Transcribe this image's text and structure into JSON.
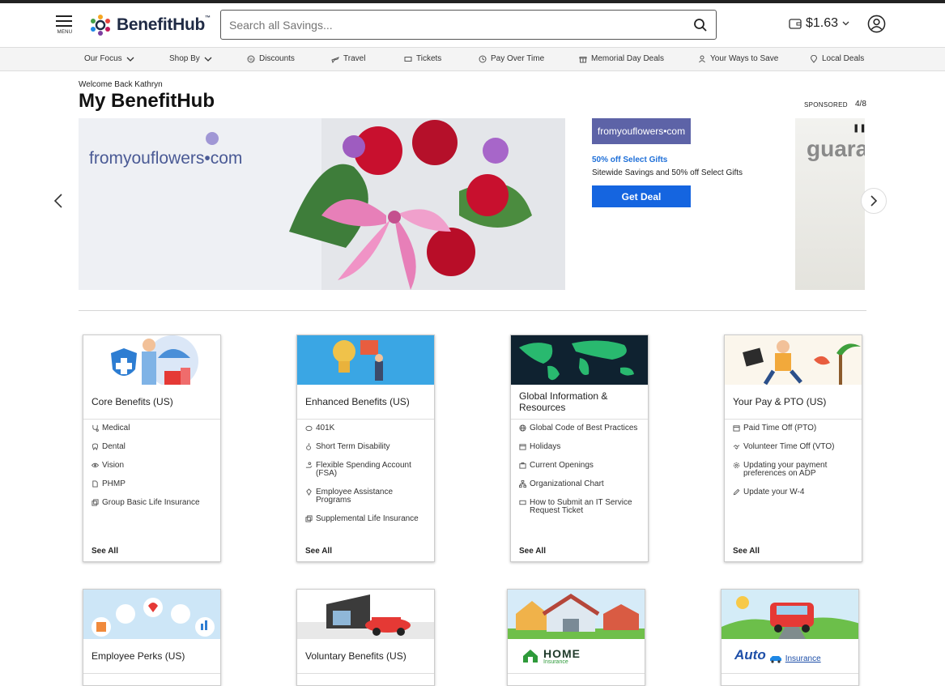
{
  "header": {
    "menu_label": "MENU",
    "logo_text": "BenefitHub",
    "logo_tm": "™",
    "search_placeholder": "Search all Savings...",
    "wallet_balance": "$1.63"
  },
  "nav": {
    "items": [
      "Our Focus",
      "Shop By",
      "Discounts",
      "Travel",
      "Tickets",
      "Pay Over Time",
      "Memorial Day Deals",
      "Your Ways to Save",
      "Local Deals"
    ]
  },
  "main": {
    "welcome": "Welcome Back Kathryn",
    "title": "My BenefitHub",
    "sponsored": "SPONSORED",
    "pager": "4/8"
  },
  "carousel": {
    "brand": "fromyouflowers•com",
    "deal_logo": "fromyouflowers•com",
    "deal_title": "50% off Select Gifts",
    "deal_description": "Sitewide Savings and 50% off Select Gifts",
    "deal_button": "Get Deal",
    "next_partial_text": "guara"
  },
  "cards": [
    {
      "title": "Core Benefits (US)",
      "items": [
        "Medical",
        "Dental",
        "Vision",
        "PHMP",
        "Group Basic Life Insurance"
      ],
      "see_all": "See All"
    },
    {
      "title": "Enhanced Benefits (US)",
      "items": [
        "401K",
        "Short Term Disability",
        "Flexible Spending Account (FSA)",
        "Employee Assistance Programs",
        "Supplemental Life Insurance"
      ],
      "see_all": "See All"
    },
    {
      "title": "Global Information & Resources",
      "items": [
        "Global Code of Best Practices",
        "Holidays",
        "Current Openings",
        "Organizational Chart",
        "How to Submit an IT Service Request Ticket"
      ],
      "see_all": "See All"
    },
    {
      "title": "Your Pay & PTO (US)",
      "items": [
        "Paid Time Off (PTO)",
        "Volunteer Time Off (VTO)",
        "Updating your payment preferences on ADP",
        "Update your W-4"
      ],
      "see_all": "See All"
    },
    {
      "title": "Employee Perks (US)"
    },
    {
      "title": "Voluntary Benefits (US)"
    },
    {
      "title": "HOME",
      "subtitle": "Insurance"
    },
    {
      "title": "Auto",
      "subtitle": "Insurance"
    }
  ],
  "colors": {
    "accent": "#1565e0",
    "brand_dark": "#1f2a44",
    "deal_link": "#1e6fd8"
  }
}
